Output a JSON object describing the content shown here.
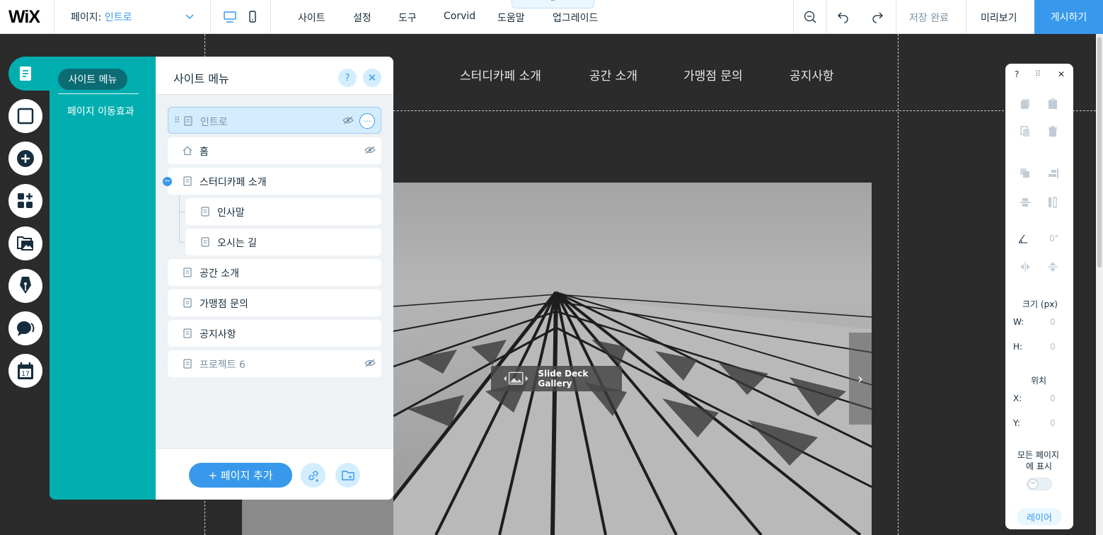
{
  "topbar": {
    "logo": "WiX",
    "page_prefix": "페이지: ",
    "current_page": "인트로",
    "menu": [
      "사이트",
      "설정",
      "도구",
      "Corvid",
      "도움말",
      "업그레이드"
    ],
    "saved_label": "저장 완료",
    "preview_label": "미리보기",
    "publish_label": "게시하기",
    "handle_glyph": "⌃"
  },
  "site_nav": [
    "스터디카페 소개",
    "공간 소개",
    "가맹점 문의",
    "공지사항"
  ],
  "gallery": {
    "label": "Slide Deck Gallery",
    "next_glyph": "›"
  },
  "pages_panel": {
    "tabs": [
      "사이트 메뉴",
      "페이지 이동효과"
    ],
    "title": "사이트 메뉴",
    "help_glyph": "?",
    "close_glyph": "✕",
    "pages": [
      {
        "label": "인트로",
        "hidden": true,
        "selected": true
      },
      {
        "label": "홈",
        "hidden": true
      },
      {
        "label": "스터디카페 소개"
      },
      {
        "label": "인사말",
        "sub": true
      },
      {
        "label": "오시는 길",
        "sub": true
      },
      {
        "label": "공간 소개"
      },
      {
        "label": "가맹점 문의"
      },
      {
        "label": "공지사항"
      },
      {
        "label": "프로젝트 6",
        "hidden": true
      }
    ],
    "more_glyph": "···",
    "drag_glyph": "⠿",
    "collapse_glyph": "−",
    "add_page_label": "+ 페이지 추가"
  },
  "inspector": {
    "help_glyph": "?",
    "drag_glyph": "⠿",
    "close_glyph": "✕",
    "rotation_value": "0°",
    "size_label": "크기 (px)",
    "w_label": "W:",
    "w_value": "0",
    "h_label": "H:",
    "h_value": "0",
    "position_label": "위치",
    "x_label": "X:",
    "x_value": "0",
    "y_label": "Y:",
    "y_value": "0",
    "show_all_label_1": "모든 페이지",
    "show_all_label_2": "에 표시",
    "toggle_glyph": "−",
    "show_all_pages": false,
    "layer_label": "레이어"
  },
  "colors": {
    "accent": "#3899ec",
    "teal": "#00aeb0",
    "canvas": "#2b2b2b"
  }
}
